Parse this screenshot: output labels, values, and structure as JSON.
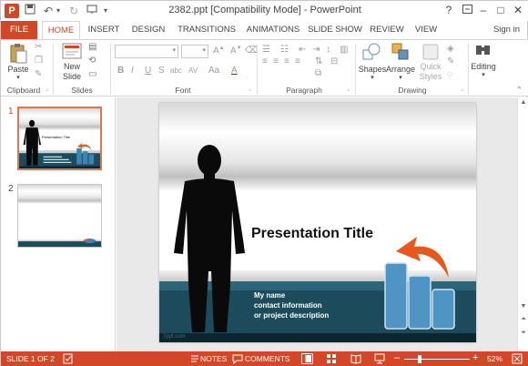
{
  "window": {
    "title": "2382.ppt [Compatibility Mode] - PowerPoint",
    "app_icon": "P",
    "help_label": "?"
  },
  "tabs": [
    {
      "label": "FILE"
    },
    {
      "label": "HOME"
    },
    {
      "label": "INSERT"
    },
    {
      "label": "DESIGN"
    },
    {
      "label": "TRANSITIONS"
    },
    {
      "label": "ANIMATIONS"
    },
    {
      "label": "SLIDE SHOW"
    },
    {
      "label": "REVIEW"
    },
    {
      "label": "VIEW"
    }
  ],
  "account": {
    "signin_label": "Sign in"
  },
  "ribbon": {
    "clipboard": {
      "paste_label": "Paste",
      "group_label": "Clipboard"
    },
    "slides": {
      "new_slide_label_1": "New",
      "new_slide_label_2": "Slide",
      "group_label": "Slides"
    },
    "font": {
      "group_label": "Font",
      "bold": "B",
      "italic": "I",
      "underline": "U",
      "strike": "S",
      "shadow": "abc",
      "spacing": "AV",
      "case": "Aa",
      "color": "A"
    },
    "paragraph": {
      "group_label": "Paragraph"
    },
    "drawing": {
      "shapes_label": "Shapes",
      "arrange_label": "Arrange",
      "quick_styles_label_1": "Quick",
      "quick_styles_label_2": "Styles",
      "group_label": "Drawing"
    },
    "editing": {
      "label": "Editing"
    }
  },
  "thumbnails": [
    {
      "number": "1",
      "mini_title": "Presentation Title"
    },
    {
      "number": "2"
    }
  ],
  "slide": {
    "title": "Presentation Title",
    "lines": [
      "My name",
      "contact information",
      "or project description"
    ],
    "footer": "7ppt.com"
  },
  "statusbar": {
    "slide_counter": "SLIDE 1 OF 2",
    "notes_label": "NOTES",
    "comments_label": "COMMENTS",
    "zoom_percent": "52%",
    "zoom_level": 0.52
  },
  "colors": {
    "accent": "#d24726",
    "slide_teal": "#1c4c5c",
    "bar_blue": "#5a9bc4",
    "arrow_orange": "#e8581d"
  }
}
